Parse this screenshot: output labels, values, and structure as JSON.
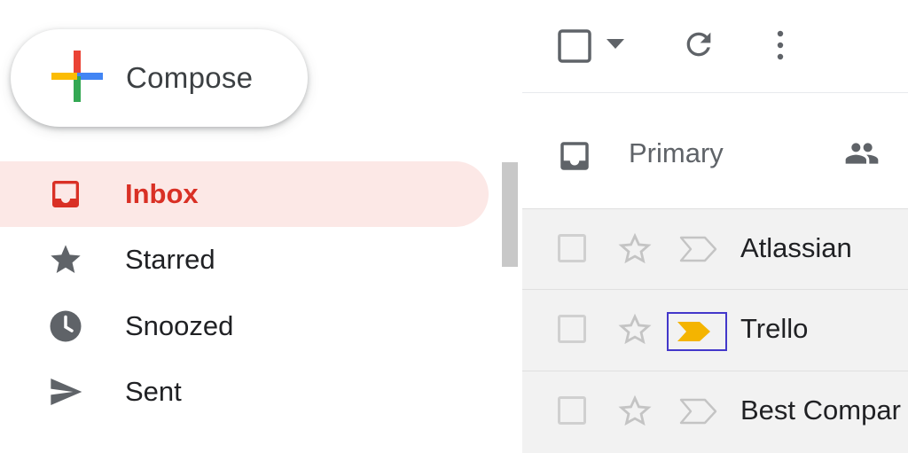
{
  "compose": {
    "label": "Compose"
  },
  "nav": {
    "items": [
      {
        "label": "Inbox",
        "icon": "inbox-icon",
        "active": true
      },
      {
        "label": "Starred",
        "icon": "star-icon"
      },
      {
        "label": "Snoozed",
        "icon": "clock-icon"
      },
      {
        "label": "Sent",
        "icon": "send-icon"
      }
    ]
  },
  "tabs": {
    "primary_label": "Primary"
  },
  "rows": [
    {
      "sender": "Atlassian",
      "important": false
    },
    {
      "sender": "Trello",
      "important": true
    },
    {
      "sender": "Best Compar",
      "important": false
    }
  ],
  "colors": {
    "active_bg": "#fce8e6",
    "active_text": "#d93025",
    "important_marker": "#f4b400",
    "highlight_border": "#4338ca"
  }
}
